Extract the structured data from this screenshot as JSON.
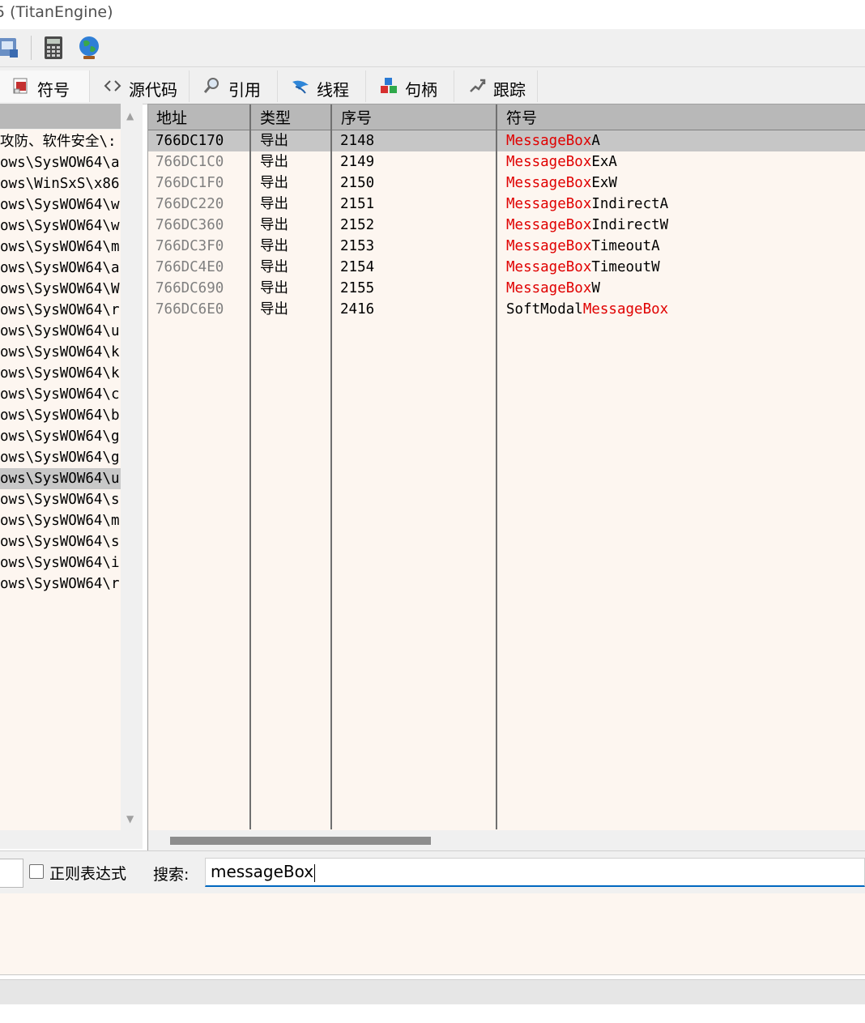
{
  "window": {
    "title": "5 (TitanEngine)"
  },
  "toolbar": {
    "icons": [
      "patch-icon",
      "calculator-icon",
      "globe-icon"
    ]
  },
  "tabs": [
    {
      "label": "符号",
      "icon": "symbol-icon",
      "active": true
    },
    {
      "label": "源代码",
      "icon": "source-code-icon"
    },
    {
      "label": "引用",
      "icon": "reference-icon"
    },
    {
      "label": "线程",
      "icon": "thread-icon"
    },
    {
      "label": "句柄",
      "icon": "handle-icon"
    },
    {
      "label": "跟踪",
      "icon": "trace-icon"
    }
  ],
  "modules": [
    "攻防、软件安全\\:",
    "ows\\SysWOW64\\a",
    "ows\\WinSxS\\x86",
    "ows\\SysWOW64\\w",
    "ows\\SysWOW64\\w",
    "ows\\SysWOW64\\m",
    "ows\\SysWOW64\\a",
    "ows\\SysWOW64\\W",
    "ows\\SysWOW64\\r",
    "ows\\SysWOW64\\u",
    "ows\\SysWOW64\\k",
    "ows\\SysWOW64\\k",
    "ows\\SysWOW64\\c",
    "ows\\SysWOW64\\b",
    "ows\\SysWOW64\\g",
    "ows\\SysWOW64\\g",
    "ows\\SysWOW64\\u",
    "ows\\SysWOW64\\s",
    "ows\\SysWOW64\\m",
    "ows\\SysWOW64\\s",
    "ows\\SysWOW64\\i",
    "ows\\SysWOW64\\r"
  ],
  "selected_module_index": 16,
  "symbols_table": {
    "columns": [
      "地址",
      "类型",
      "序号",
      "符号"
    ],
    "rows": [
      {
        "address": "766DC170",
        "type": "导出",
        "ordinal": "2148",
        "sym_prefix": "",
        "sym_match": "MessageBox",
        "sym_suffix": "A"
      },
      {
        "address": "766DC1C0",
        "type": "导出",
        "ordinal": "2149",
        "sym_prefix": "",
        "sym_match": "MessageBox",
        "sym_suffix": "ExA"
      },
      {
        "address": "766DC1F0",
        "type": "导出",
        "ordinal": "2150",
        "sym_prefix": "",
        "sym_match": "MessageBox",
        "sym_suffix": "ExW"
      },
      {
        "address": "766DC220",
        "type": "导出",
        "ordinal": "2151",
        "sym_prefix": "",
        "sym_match": "MessageBox",
        "sym_suffix": "IndirectA"
      },
      {
        "address": "766DC360",
        "type": "导出",
        "ordinal": "2152",
        "sym_prefix": "",
        "sym_match": "MessageBox",
        "sym_suffix": "IndirectW"
      },
      {
        "address": "766DC3F0",
        "type": "导出",
        "ordinal": "2153",
        "sym_prefix": "",
        "sym_match": "MessageBox",
        "sym_suffix": "TimeoutA"
      },
      {
        "address": "766DC4E0",
        "type": "导出",
        "ordinal": "2154",
        "sym_prefix": "",
        "sym_match": "MessageBox",
        "sym_suffix": "TimeoutW"
      },
      {
        "address": "766DC690",
        "type": "导出",
        "ordinal": "2155",
        "sym_prefix": "",
        "sym_match": "MessageBox",
        "sym_suffix": "W"
      },
      {
        "address": "766DC6E0",
        "type": "导出",
        "ordinal": "2416",
        "sym_prefix": "SoftModal",
        "sym_match": "MessageBox",
        "sym_suffix": ""
      }
    ],
    "selected_row_index": 0
  },
  "search": {
    "regex_label": "正则表达式",
    "regex_checked": false,
    "label": "搜索:",
    "value": "messageBox"
  },
  "colors": {
    "highlight": "#e00000",
    "row_bg": "#fdf6f0",
    "header_bg": "#b8b8b8",
    "selected_bg": "#c6c6c6"
  }
}
